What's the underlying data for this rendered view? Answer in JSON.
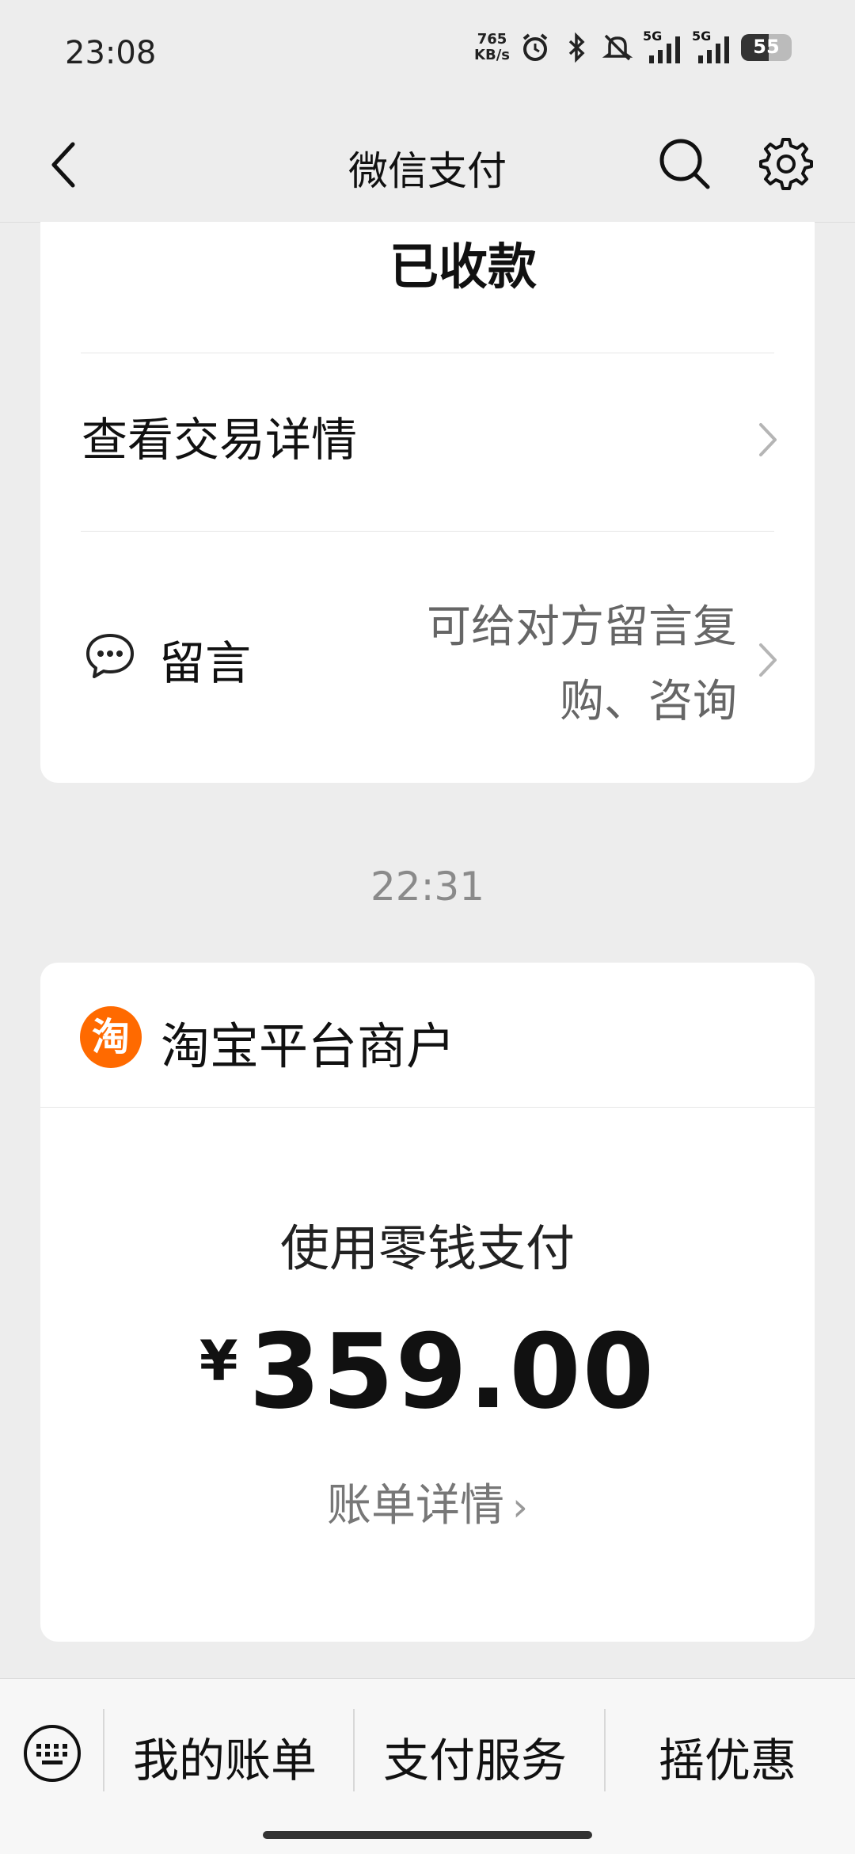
{
  "status_bar": {
    "time": "23:08",
    "net_speed_value": "765",
    "net_speed_unit": "KB/s",
    "signal_1": "5G",
    "signal_2": "5G",
    "battery": "55",
    "battery_level": 0.55,
    "icons": [
      "alarm-icon",
      "bluetooth-icon",
      "mute-icon",
      "signal-icon",
      "signal-icon",
      "battery-icon"
    ]
  },
  "header": {
    "title": "微信支付",
    "back_icon": "chevron-left-icon",
    "search_icon": "search-icon",
    "settings_icon": "gear-icon"
  },
  "card1": {
    "status": "已收款",
    "detail_label": "查看交易详情",
    "message_label": "留言",
    "message_hint_line1": "可给对方留言复",
    "message_hint_line2": "购、咨询"
  },
  "timestamp": "22:31",
  "card2": {
    "merchant_logo_char": "淘",
    "merchant_name": "淘宝平台商户",
    "merchant_logo_color": "#ff6a00",
    "pay_method": "使用零钱支付",
    "currency": "¥",
    "amount": "359.00",
    "bill_detail": "账单详情",
    "bill_arrow": "›"
  },
  "bottom_bar": {
    "items": [
      "我的账单",
      "支付服务",
      "摇优惠"
    ]
  }
}
